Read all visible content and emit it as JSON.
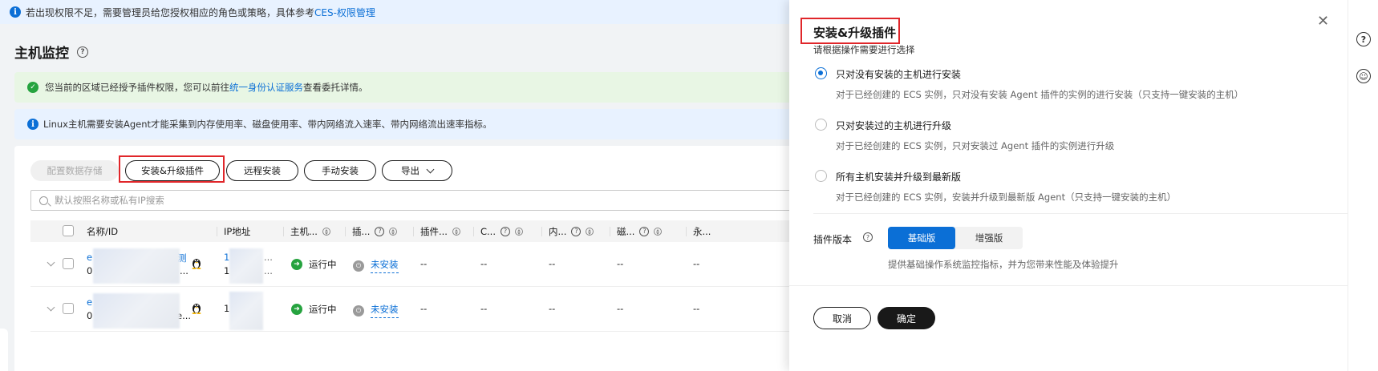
{
  "notice": {
    "text": "若出现权限不足，需要管理员给您授权相应的角色或策略，具体参考",
    "link": "CES-权限管理"
  },
  "page": {
    "title": "主机监控"
  },
  "alerts": {
    "green_text_before": "您当前的区域已经授予插件权限，您可以前往",
    "green_link": "统一身份认证服务",
    "green_text_after": "查看委托详情。",
    "blue_text": "Linux主机需要安装Agent才能采集到内存使用率、磁盘使用率、带内网络流入速率、带内网络流出速率指标。"
  },
  "toolbar": {
    "config_storage": "配置数据存储",
    "install_upgrade": "安装&升级插件",
    "remote_install": "远程安装",
    "manual_install": "手动安装",
    "export": "导出"
  },
  "search": {
    "placeholder": "默认按照名称或私有IP搜索"
  },
  "table": {
    "columns": [
      "名称/ID",
      "IP地址",
      "主机...",
      "插...",
      "插件...",
      "C...",
      "内...",
      "磁...",
      "永..."
    ],
    "rows": [
      {
        "name_prefix": "e",
        "name_suffix": "测",
        "id_prefix": "0",
        "id_suffix": "...",
        "ip_prefix": "1",
        "ip_line2": "1",
        "ip_suffix": "...",
        "ip_suffix2": "...",
        "status": "运行中",
        "plugin": "未安装",
        "c5": "--",
        "c6": "--",
        "c7": "--",
        "c8": "--",
        "c9": "--"
      },
      {
        "name_prefix": "e",
        "name_suffix": "",
        "id_prefix": "0",
        "id_suffix": "e...",
        "ip_prefix": "1",
        "ip_line2": "",
        "ip_suffix": "...",
        "ip_suffix2": "",
        "status": "运行中",
        "plugin": "未安装",
        "c5": "--",
        "c6": "--",
        "c7": "--",
        "c8": "--",
        "c9": "--"
      }
    ]
  },
  "drawer": {
    "title": "安装&升级插件",
    "subtitle": "请根据操作需要进行选择",
    "options": [
      {
        "title": "只对没有安装的主机进行安装",
        "desc": "对于已经创建的 ECS 实例，只对没有安装 Agent 插件的实例的进行安装（只支持一键安装的主机）",
        "selected": true
      },
      {
        "title": "只对安装过的主机进行升级",
        "desc": "对于已经创建的 ECS 实例，只对安装过 Agent 插件的实例进行升级",
        "selected": false
      },
      {
        "title": "所有主机安装并升级到最新版",
        "desc": "对于已经创建的 ECS 实例，安装并升级到最新版 Agent（只支持一键安装的主机）",
        "selected": false
      }
    ],
    "version_label": "插件版本",
    "version_basic": "基础版",
    "version_enhanced": "增强版",
    "version_desc": "提供基础操作系统监控指标，并为您带来性能及体验提升",
    "cancel": "取消",
    "confirm": "确定"
  },
  "colors": {
    "primary": "#0b6fd6",
    "highlight": "#e0262a",
    "success": "#26a33f"
  }
}
